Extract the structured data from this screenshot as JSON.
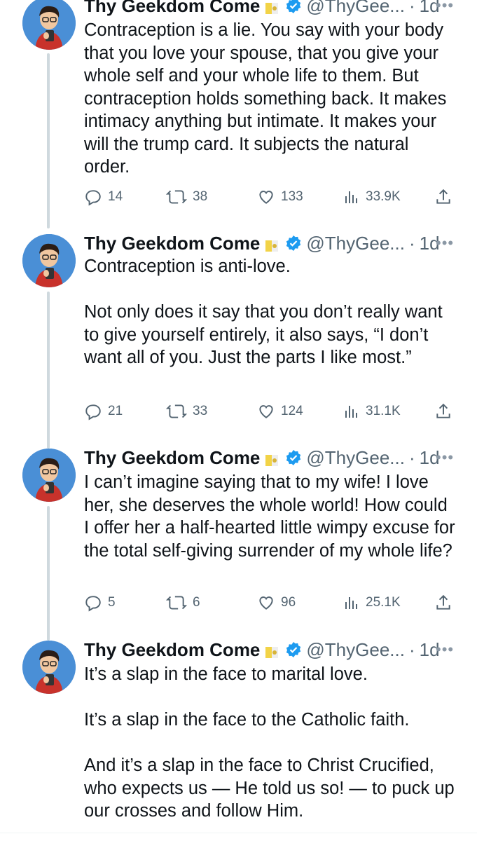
{
  "author": {
    "name": "Thy Geekdom Come",
    "handle": "@ThyGee...",
    "separator": "·"
  },
  "tweets": [
    {
      "time": "1d",
      "handle_display": "@ThyGee...",
      "paragraphs": [
        "Contraception is a lie. You say with your body that you love your spouse, that you give your whole self and your whole life to them. But contraception holds something back. It makes intimacy anything but intimate. It makes your will the trump card. It subjects the natural order."
      ],
      "replies": "14",
      "retweets": "38",
      "likes": "133",
      "views": "33.9K"
    },
    {
      "time": "1d",
      "handle_display": "@ThyGee...",
      "paragraphs": [
        "Contraception is anti-love.",
        "Not only does it say that you don’t really want to give yourself entirely, it also says, “I don’t want all of you. Just the parts I like most.”"
      ],
      "replies": "21",
      "retweets": "33",
      "likes": "124",
      "views": "31.1K"
    },
    {
      "time": "1d",
      "handle_display": "@ThyGee...",
      "paragraphs": [
        "I can’t imagine saying that to my wife! I love her, she deserves the whole world! How could I offer her a half-hearted little wimpy excuse for the total self-giving surrender of my whole life?"
      ],
      "replies": "5",
      "retweets": "6",
      "likes": "96",
      "views": "25.1K"
    },
    {
      "time": "1d",
      "handle_display": "@ThyGee...",
      "paragraphs": [
        "It’s a slap in the face to marital love.",
        "It’s a slap in the face to the Catholic faith.",
        "And it’s a slap in the face to Christ Crucified, who expects us — He told us so! — to puck up our crosses and follow Him."
      ]
    }
  ],
  "colors": {
    "verified": "#1d9bf0",
    "muted": "#536471",
    "thread_line": "#cfd9de",
    "avatar_bg": "#4a8fd6"
  },
  "icons": [
    "reply-icon",
    "retweet-icon",
    "like-icon",
    "views-icon",
    "share-icon",
    "verified-badge-icon",
    "papal-flag-icon",
    "more-icon"
  ]
}
